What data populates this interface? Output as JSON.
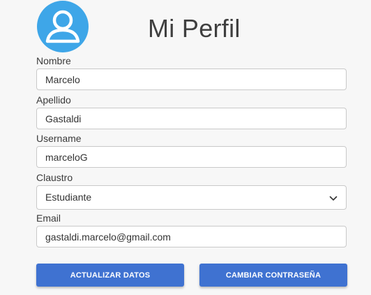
{
  "header": {
    "title": "Mi Perfil",
    "avatar_icon": "user-avatar-icon",
    "avatar_color": "#3ea6e8"
  },
  "form": {
    "nombre": {
      "label": "Nombre",
      "value": "Marcelo"
    },
    "apellido": {
      "label": "Apellido",
      "value": "Gastaldi"
    },
    "username": {
      "label": "Username",
      "value": "marceloG"
    },
    "claustro": {
      "label": "Claustro",
      "value": "Estudiante",
      "icon": "chevron-down-icon"
    },
    "email": {
      "label": "Email",
      "value": "gastaldi.marcelo@gmail.com"
    }
  },
  "actions": {
    "update_label": "ACTUALIZAR DATOS",
    "change_password_label": "CAMBIAR CONTRASEÑA",
    "button_color": "#3f72d1"
  }
}
